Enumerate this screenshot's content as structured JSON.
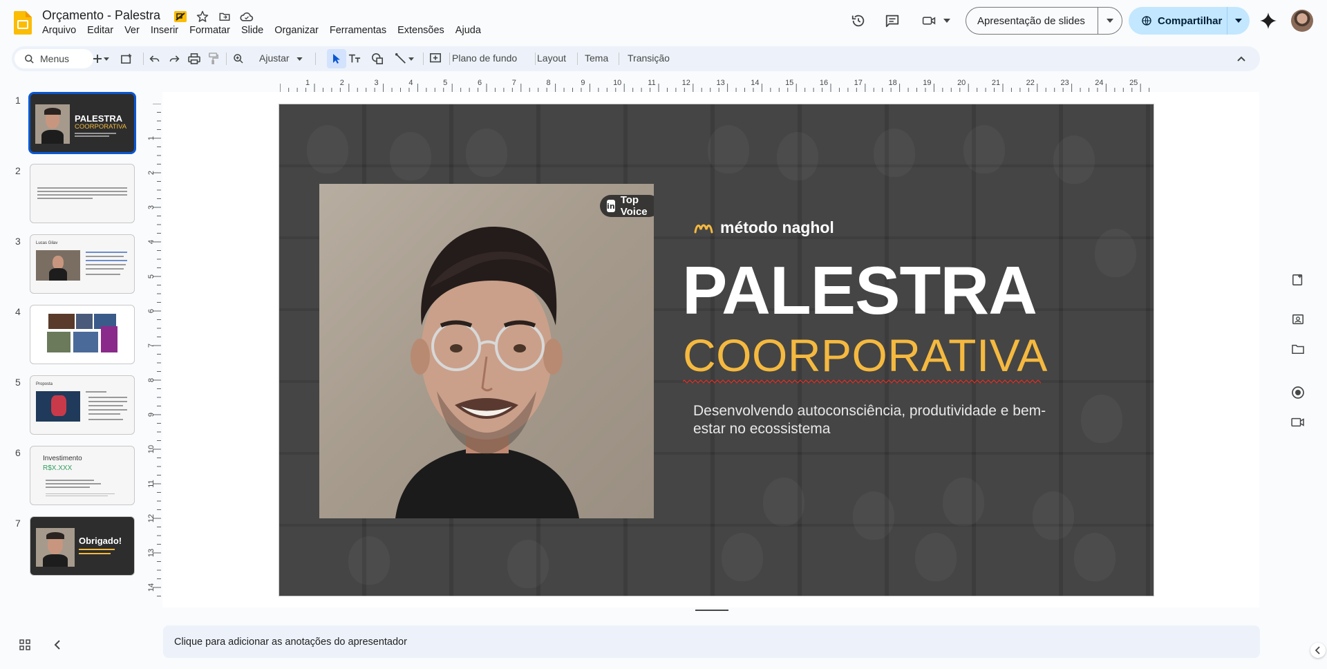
{
  "header": {
    "doc_title": "Orçamento - Palestra",
    "menus": [
      "Arquivo",
      "Editar",
      "Ver",
      "Inserir",
      "Formatar",
      "Slide",
      "Organizar",
      "Ferramentas",
      "Extensões",
      "Ajuda"
    ],
    "present_label": "Apresentação de slides",
    "share_label": "Compartilhar"
  },
  "toolbar": {
    "search_label": "Menus",
    "zoom_label": "Ajustar",
    "background_label": "Plano de fundo",
    "layout_label": "Layout",
    "theme_label": "Tema",
    "transition_label": "Transição"
  },
  "ruler": {
    "horizontal": [
      "1",
      "2",
      "3",
      "4",
      "5",
      "6",
      "7",
      "8",
      "9",
      "10",
      "11",
      "12",
      "13",
      "14",
      "15",
      "16",
      "17",
      "18",
      "19",
      "20",
      "21",
      "22",
      "23",
      "24",
      "25"
    ],
    "vertical": [
      "1",
      "2",
      "3",
      "4",
      "5",
      "6",
      "7",
      "8",
      "9",
      "10",
      "11",
      "12",
      "13",
      "14"
    ]
  },
  "filmstrip": {
    "slides": [
      {
        "num": "1",
        "title": "PALESTRA",
        "sub": "COORPORATIVA"
      },
      {
        "num": "2"
      },
      {
        "num": "3",
        "title": "Lucas Gilav"
      },
      {
        "num": "4"
      },
      {
        "num": "5",
        "title": "Proposta"
      },
      {
        "num": "6",
        "title": "Investimento",
        "sub": "R$X.XXX"
      },
      {
        "num": "7",
        "title": "Obrigado!"
      }
    ]
  },
  "slide": {
    "badge": "Top Voice",
    "brand": "método naghol",
    "title": "PALESTRA",
    "subtitle": "COORPORATIVA",
    "description": "Desenvolvendo autoconsciência, produtividade e bem-estar no ecossistema"
  },
  "notes": {
    "placeholder": "Clique para adicionar as anotações do apresentador"
  },
  "colors": {
    "accent": "#0b57d0",
    "share_bg": "#c2e7ff",
    "slide_bg": "#3b3b3b",
    "title_yellow": "#f5b93f",
    "app_logo": "#fbbc04"
  }
}
